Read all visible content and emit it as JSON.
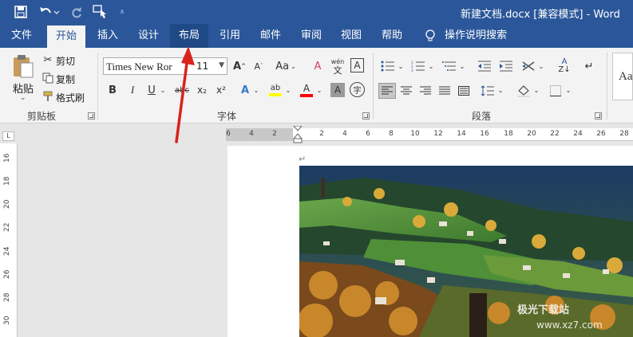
{
  "titlebar": {
    "title": "新建文档.docx [兼容模式] - Word",
    "qat": [
      "save-icon",
      "undo-icon",
      "redo-icon",
      "touch-mode-icon",
      "customize-qat-icon"
    ]
  },
  "tabs": [
    {
      "label": "文件"
    },
    {
      "label": "开始"
    },
    {
      "label": "插入"
    },
    {
      "label": "设计"
    },
    {
      "label": "布局"
    },
    {
      "label": "引用"
    },
    {
      "label": "邮件"
    },
    {
      "label": "审阅"
    },
    {
      "label": "视图"
    },
    {
      "label": "帮助"
    },
    {
      "label": "操作说明搜索"
    }
  ],
  "clipboard": {
    "paste": "粘贴",
    "cut": "剪切",
    "copy": "复制",
    "format_painter": "格式刷",
    "group": "剪贴板"
  },
  "font": {
    "name": "Times New Ror",
    "size": "11",
    "group": "字体",
    "change_case": "Aa",
    "phonetic": "wén",
    "phonetic_sub": "文",
    "border_char": "A",
    "bold": "B",
    "italic": "I",
    "underline": "U",
    "strike": "abc",
    "subscript": "x₂",
    "superscript": "x²",
    "highlight": "ab",
    "font_color": "A",
    "shading": "A",
    "enclose": "字"
  },
  "paragraph": {
    "group": "段落"
  },
  "styles": {
    "preview": "Aa"
  },
  "ruler": {
    "top_numbers": [
      "6",
      "4",
      "2",
      "",
      "2",
      "4",
      "6",
      "8",
      "10",
      "12",
      "14",
      "16",
      "18",
      "20",
      "22",
      "24",
      "26",
      "28"
    ],
    "vertical_numbers": [
      "16",
      "18",
      "20",
      "22",
      "24",
      "26",
      "28",
      "30"
    ]
  },
  "watermark": {
    "line1": "极光下载站",
    "line2": "www.xz7.com"
  },
  "colors": {
    "accent": "#2b579a",
    "ribbon": "#f3f3f3",
    "highlight_yellow": "#ffff00",
    "font_red": "#ff0000",
    "arrow_red": "#d9221b"
  }
}
